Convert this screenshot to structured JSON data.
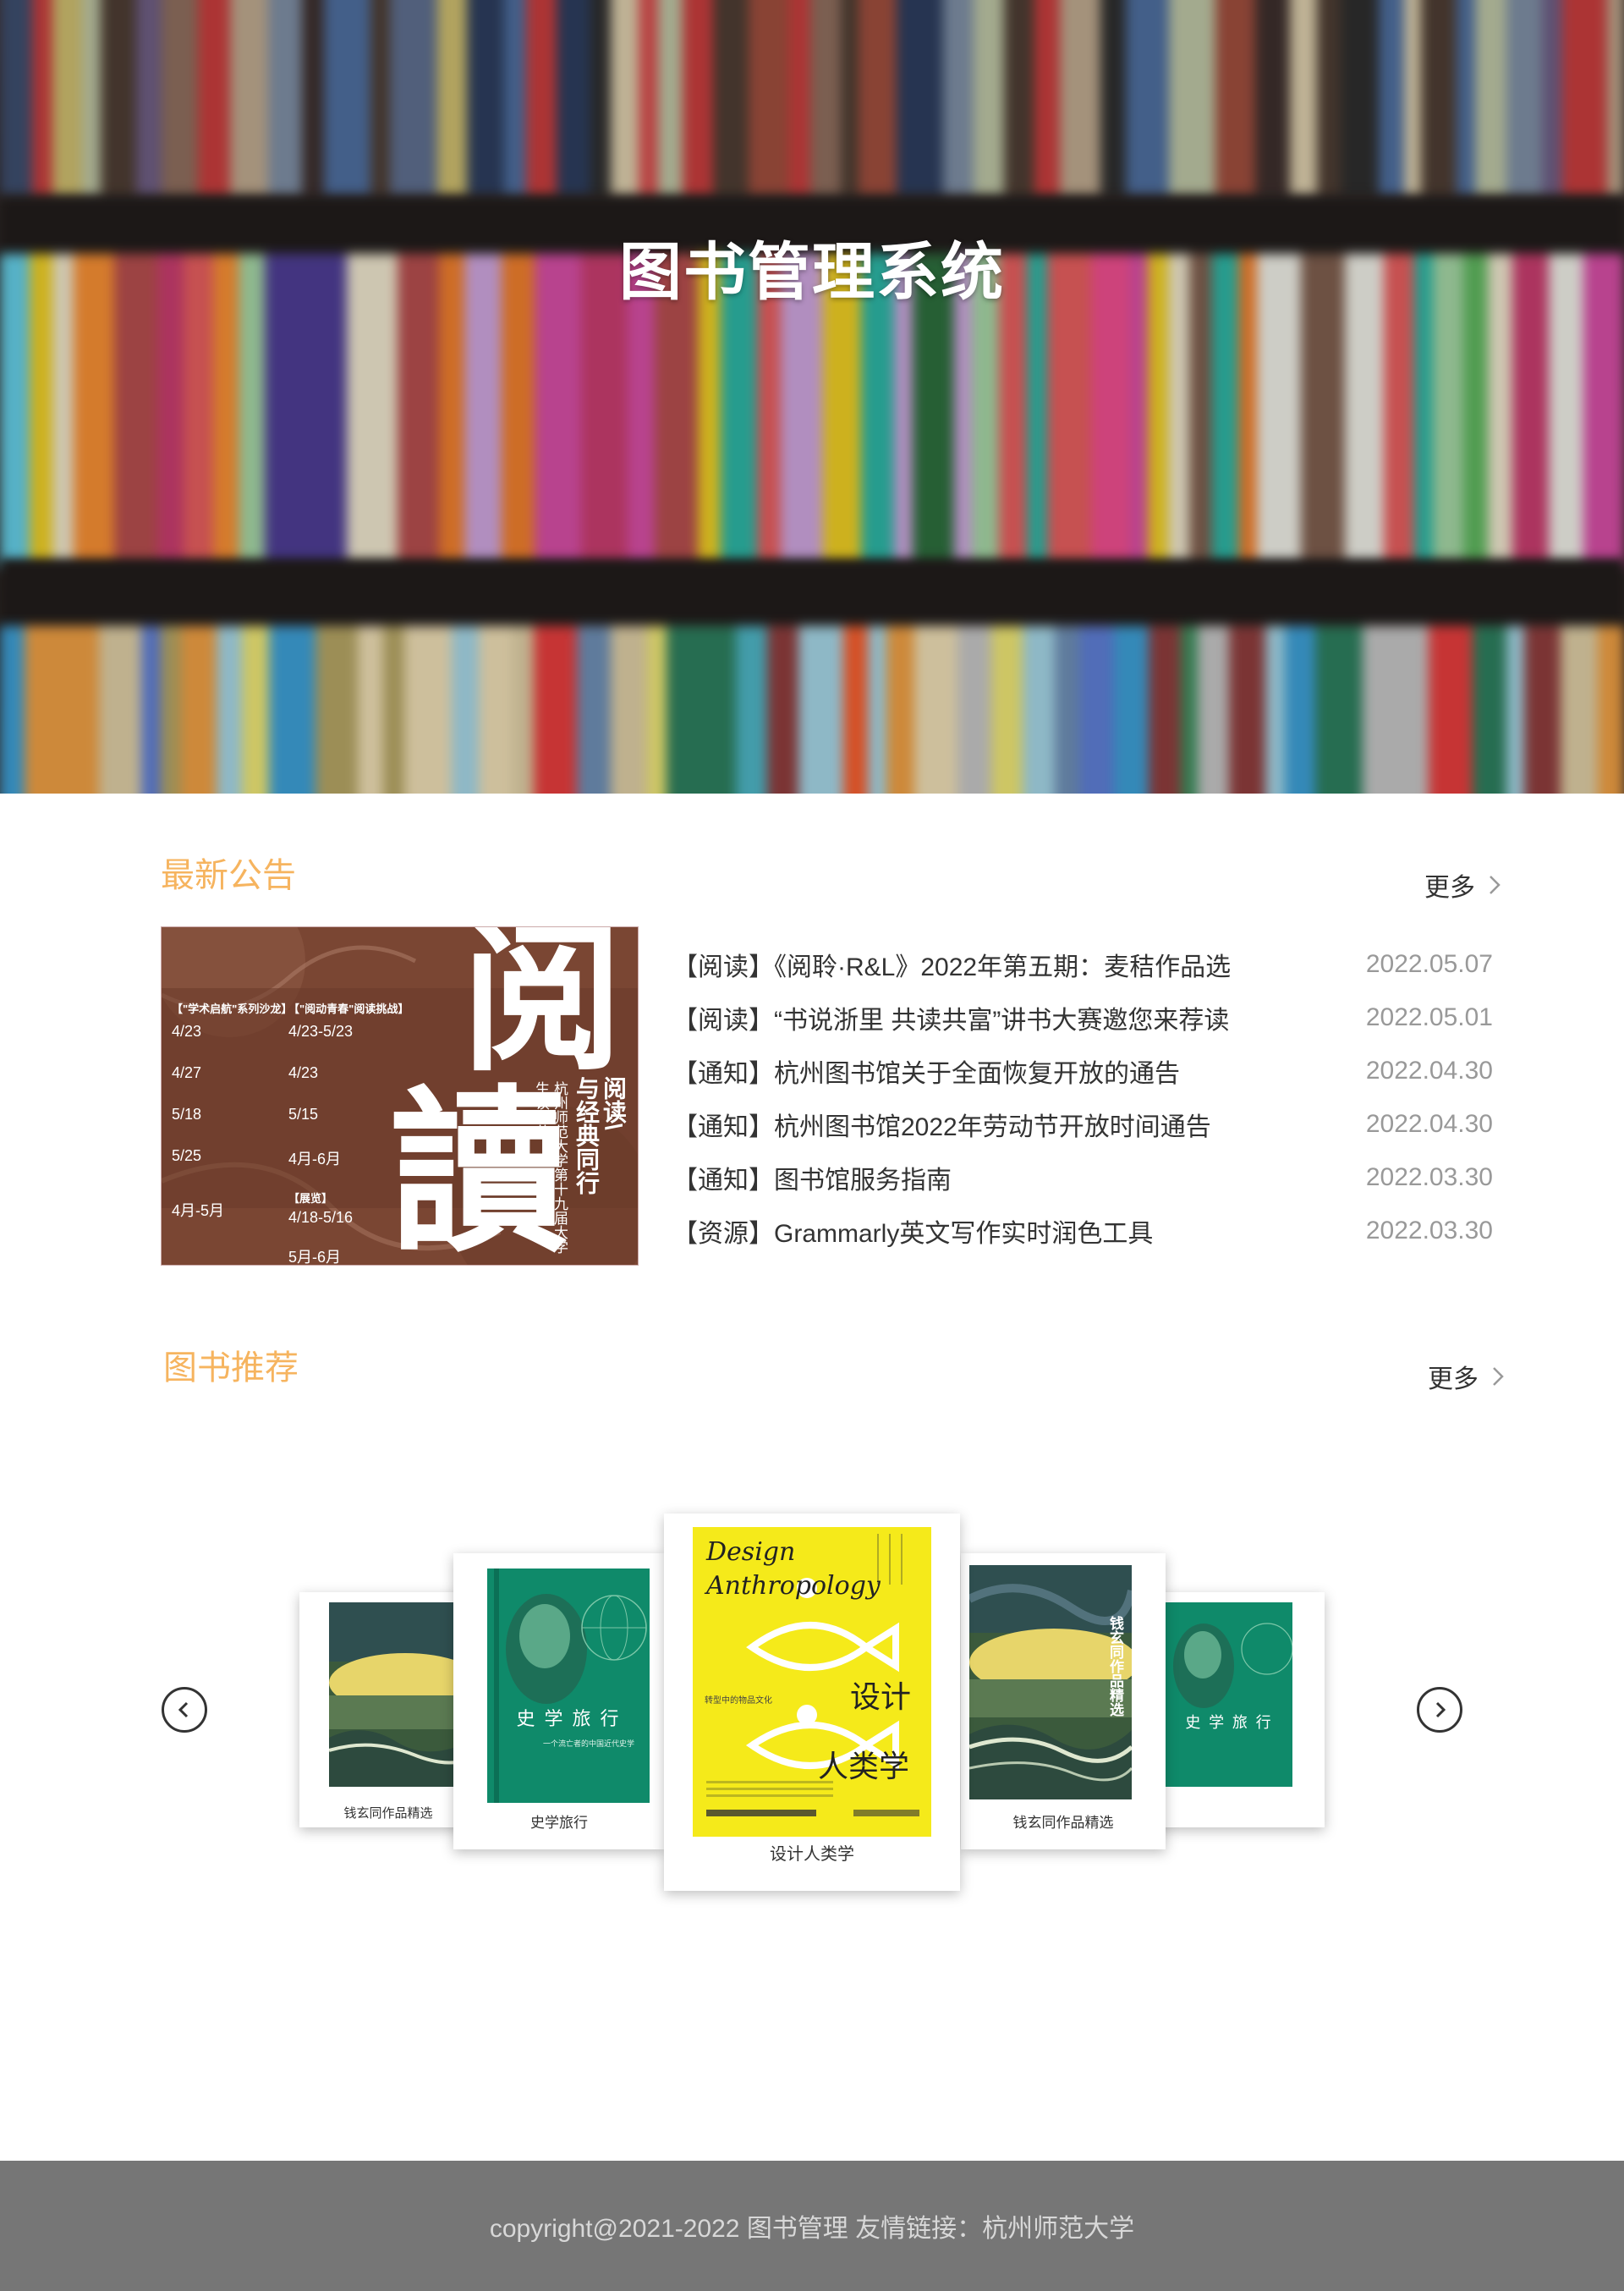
{
  "hero": {
    "title": "图书管理系统"
  },
  "notice": {
    "title": "最新公告",
    "more_label": "更多",
    "poster": {
      "big_chars": [
        "阅",
        "讀"
      ],
      "vertical_lines": [
        "阅读\\",
        "与经典同行",
        "杭州师范大学第十九届大学",
        "生读书节"
      ],
      "col1_header": "【\"学术启航\"系列沙龙】",
      "col1_items": [
        "4/23",
        "4/27",
        "5/18",
        "5/25",
        "4月-5月"
      ],
      "col2_header": "【\"阅动青春\"阅读挑战】",
      "col2_items": [
        "4/23-5/23",
        "4/23",
        "5/15",
        "4月-6月"
      ],
      "col2_sub_header": "【展览】",
      "col2_sub_items": [
        "4/18-5/16",
        "5月-6月"
      ]
    },
    "items": [
      {
        "text": "【阅读】《阅聆·R&L》2022年第五期：麦秸作品选",
        "date": "2022.05.07"
      },
      {
        "text": "【阅读】“书说浙里 共读共富”讲书大赛邀您来荐读",
        "date": "2022.05.01"
      },
      {
        "text": "【通知】杭州图书馆关于全面恢复开放的通告",
        "date": "2022.04.30"
      },
      {
        "text": "【通知】杭州图书馆2022年劳动节开放时间通告",
        "date": "2022.04.30"
      },
      {
        "text": "【通知】图书馆服务指南",
        "date": "2022.03.30"
      },
      {
        "text": "【资源】Grammarly英文写作实时润色工具",
        "date": "2022.03.30"
      }
    ]
  },
  "books": {
    "title": "图书推荐",
    "more_label": "更多",
    "cards": [
      {
        "caption": "钱玄同作品精选",
        "cover_title": "钱玄同作品精选"
      },
      {
        "caption": "史学旅行",
        "cover_title": "史 学 旅 行",
        "cover_sub": "一个流亡者的中国近代史学"
      },
      {
        "caption": "设计人类学",
        "cover_title_en_1": "Design",
        "cover_title_en_2": "Anthropology",
        "cover_title_cn_1": "设计",
        "cover_title_cn_2": "人类学",
        "cover_sub": "转型中的物品文化"
      },
      {
        "caption": "钱玄同作品精选",
        "cover_title": "钱玄同作品精选"
      },
      {
        "caption": "",
        "cover_title": "史 学 旅 行"
      }
    ]
  },
  "footer": {
    "text": "copyright@2021-2022 图书管理  友情链接：杭州师范大学"
  },
  "colors": {
    "accent": "#f6b45f",
    "footer_bg": "#767676",
    "book_green": "#0f8a6a",
    "book_yellow": "#f5ea1a"
  }
}
